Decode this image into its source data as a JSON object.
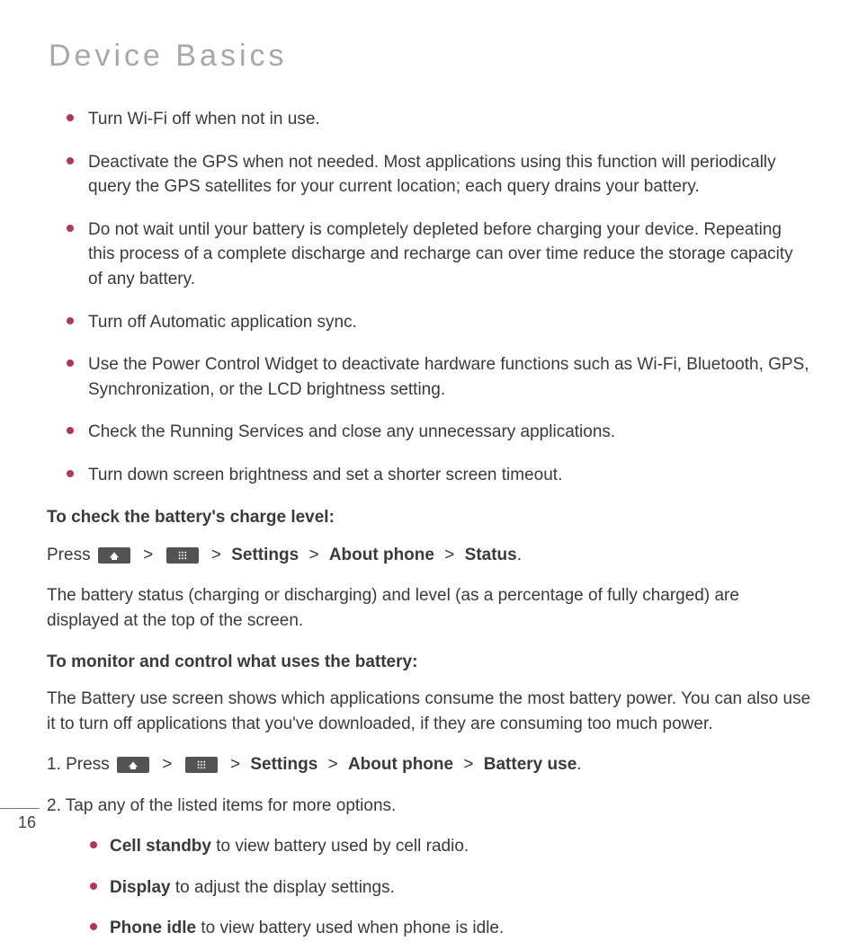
{
  "title": "Device Basics",
  "tips": [
    "Turn Wi-Fi off when not in use.",
    "Deactivate the GPS when not needed. Most applications using this function will periodically query the GPS satellites for your current location; each query drains your battery.",
    "Do not wait until your battery is completely depleted before charging your device. Repeating this process of a complete discharge and recharge can over time reduce the storage capacity of any battery.",
    "Turn off Automatic application sync.",
    "Use the Power Control Widget to deactivate hardware functions such as Wi-Fi, Bluetooth, GPS, Synchronization, or the LCD brightness setting.",
    "Check the Running Services and close any unnecessary applications.",
    "Turn down screen brightness and set a shorter screen timeout."
  ],
  "check": {
    "heading": "To check the battery's charge level:",
    "press_word": "Press",
    "path": {
      "settings": "Settings",
      "about": "About phone",
      "status": "Status"
    },
    "description": "The battery status (charging or discharging) and level (as a percentage of fully charged) are displayed at the top of the screen."
  },
  "monitor": {
    "heading": "To monitor and control what uses the battery:",
    "description": "The Battery use screen shows which applications consume the most battery power. You can also use it to turn off applications that you've downloaded, if they are consuming too much power.",
    "step1_prefix": "1. Press",
    "step1_path": {
      "settings": "Settings",
      "about": "About phone",
      "battery": "Battery use"
    },
    "step2": "2. Tap any of the listed items for more options.",
    "options": [
      {
        "b": "Cell standby",
        "rest": " to view battery used by cell radio."
      },
      {
        "b": "Display",
        "rest": " to adjust the display settings."
      },
      {
        "b": "Phone idle",
        "rest": " to view battery used when phone is idle."
      }
    ]
  },
  "page_number": "16",
  "glyphs": {
    "gt": ">"
  }
}
